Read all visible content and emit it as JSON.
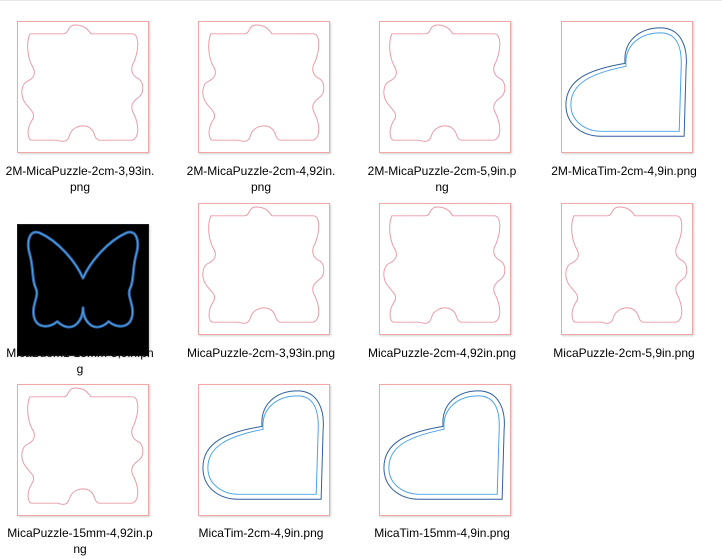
{
  "colors": {
    "outline_red": "#e99aa6",
    "outline_blue": "#4aa3e8",
    "outline_dark_blue": "#2f5f9e",
    "thumb_border": "#f2a7a7"
  },
  "files": [
    {
      "name": "2M-MicaPuzzle-2cm-3,93in.png",
      "thumbnail": "puzzle-piece"
    },
    {
      "name": "2M-MicaPuzzle-2cm-4,92in.png",
      "thumbnail": "puzzle-piece"
    },
    {
      "name": "2M-MicaPuzzle-2cm-5,9in.png",
      "thumbnail": "puzzle-piece"
    },
    {
      "name": "2M-MicaTim-2cm-4,9in.png",
      "thumbnail": "heart"
    },
    {
      "name": "MicaBuom1-15mm-5,9in.png",
      "thumbnail": "butterfly"
    },
    {
      "name": "MicaPuzzle-2cm-3,93in.png",
      "thumbnail": "puzzle-piece"
    },
    {
      "name": "MicaPuzzle-2cm-4,92in.png",
      "thumbnail": "puzzle-piece"
    },
    {
      "name": "MicaPuzzle-2cm-5,9in.png",
      "thumbnail": "puzzle-piece"
    },
    {
      "name": "MicaPuzzle-15mm-4,92in.png",
      "thumbnail": "puzzle-piece"
    },
    {
      "name": "MicaTim-2cm-4,9in.png",
      "thumbnail": "heart"
    },
    {
      "name": "MicaTim-15mm-4,9in.png",
      "thumbnail": "heart"
    }
  ]
}
